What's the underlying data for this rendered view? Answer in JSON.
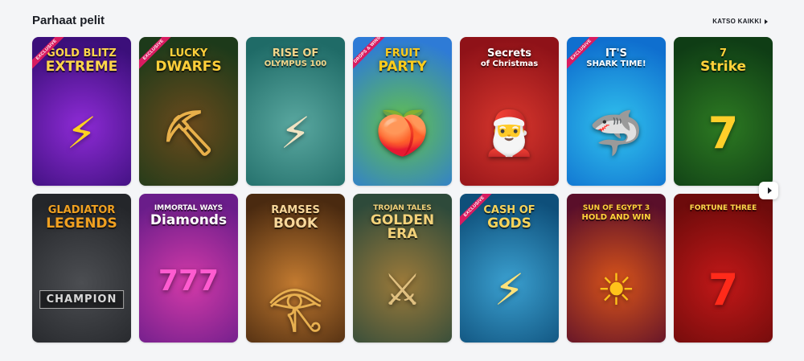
{
  "section": {
    "title": "Parhaat pelit",
    "see_all_label": "KATSO KAIKKI"
  },
  "games": [
    {
      "title_line1": "GOLD BLITZ",
      "title_line2": "EXTREME",
      "badge": "EXCLUSIVE",
      "bg1": "#3b0f7a",
      "bg2": "#8e2bd6",
      "text_color": "#ffd64a",
      "symbol": "⚡",
      "symbol_color": "#ffd21f"
    },
    {
      "title_line1": "LUCKY",
      "title_line2": "DWARFS",
      "badge": "EXCLUSIVE",
      "bg1": "#1d3a1a",
      "bg2": "#6b4a1c",
      "text_color": "#ffcf3a",
      "symbol": "⛏",
      "symbol_color": "#e8b04a"
    },
    {
      "title_line1": "RISE OF",
      "title_line2": "OLYMPUS 100",
      "badge": "",
      "bg1": "#1f6b67",
      "bg2": "#5aa8a0",
      "text_color": "#f2d58a",
      "symbol": "⚡",
      "symbol_color": "#f1e3c2"
    },
    {
      "title_line1": "FRUIT",
      "title_line2": "PARTY",
      "badge": "DROPS & WINS",
      "bg1": "#2e7bd6",
      "bg2": "#64c24a",
      "text_color": "#ffcc1a",
      "symbol": "🍑",
      "symbol_color": "#ffb100"
    },
    {
      "title_line1": "Secrets",
      "title_line2": "of Christmas",
      "badge": "",
      "bg1": "#8f1218",
      "bg2": "#d8372d",
      "text_color": "#ffffff",
      "symbol": "🎅",
      "symbol_color": "#ffffff"
    },
    {
      "title_line1": "IT'S",
      "title_line2": "SHARK TIME!",
      "badge": "EXCLUSIVE",
      "bg1": "#0f6fcf",
      "bg2": "#31c3ee",
      "text_color": "#ffffff",
      "symbol": "🦈",
      "symbol_color": "#ffc72c"
    },
    {
      "title_line1": "7",
      "title_line2": "Strike",
      "badge": "",
      "bg1": "#0f3d15",
      "bg2": "#2d7a22",
      "text_color": "#ffd23a",
      "symbol": "7",
      "symbol_color": "#ffcf2a"
    },
    {
      "title_line1": "GLADIATOR",
      "title_line2": "LEGENDS",
      "badge": "",
      "bg1": "#24262a",
      "bg2": "#4c4e52",
      "text_color": "#f0a020",
      "symbol": "CHAMPION",
      "symbol_color": "#d8d8d8"
    },
    {
      "title_line1": "IMMORTAL WAYS",
      "title_line2": "Diamonds",
      "badge": "",
      "bg1": "#6a1d8a",
      "bg2": "#d33aa8",
      "text_color": "#ffffff",
      "symbol": "777",
      "symbol_color": "#ff5bd0"
    },
    {
      "title_line1": "RAMSES",
      "title_line2": "BOOK",
      "badge": "",
      "bg1": "#4a2a10",
      "bg2": "#c27a30",
      "text_color": "#f7d79a",
      "symbol": "𓂀",
      "symbol_color": "#e8b050"
    },
    {
      "title_line1": "TROJAN TALES",
      "title_line2": "GOLDEN ERA",
      "badge": "",
      "bg1": "#2e4a3a",
      "bg2": "#9c7a3a",
      "text_color": "#f3d27a",
      "symbol": "⚔",
      "symbol_color": "#e0c080"
    },
    {
      "title_line1": "CASH OF",
      "title_line2": "GODS",
      "badge": "EXCLUSIVE",
      "bg1": "#0e4f7a",
      "bg2": "#3ba0d0",
      "text_color": "#f7d35a",
      "symbol": "⚡",
      "symbol_color": "#ffe27a"
    },
    {
      "title_line1": "SUN OF EGYPT 3",
      "title_line2": "HOLD AND WIN",
      "badge": "",
      "bg1": "#5a0f2a",
      "bg2": "#d8541a",
      "text_color": "#ffd23a",
      "symbol": "☀",
      "symbol_color": "#ffc21a"
    },
    {
      "title_line1": "FORTUNE THREE",
      "title_line2": "",
      "badge": "",
      "bg1": "#6d0b0b",
      "bg2": "#c21818",
      "text_color": "#ffd84a",
      "symbol": "7",
      "symbol_color": "#ff2a1a"
    }
  ],
  "carousel": {
    "next_label": "next"
  }
}
